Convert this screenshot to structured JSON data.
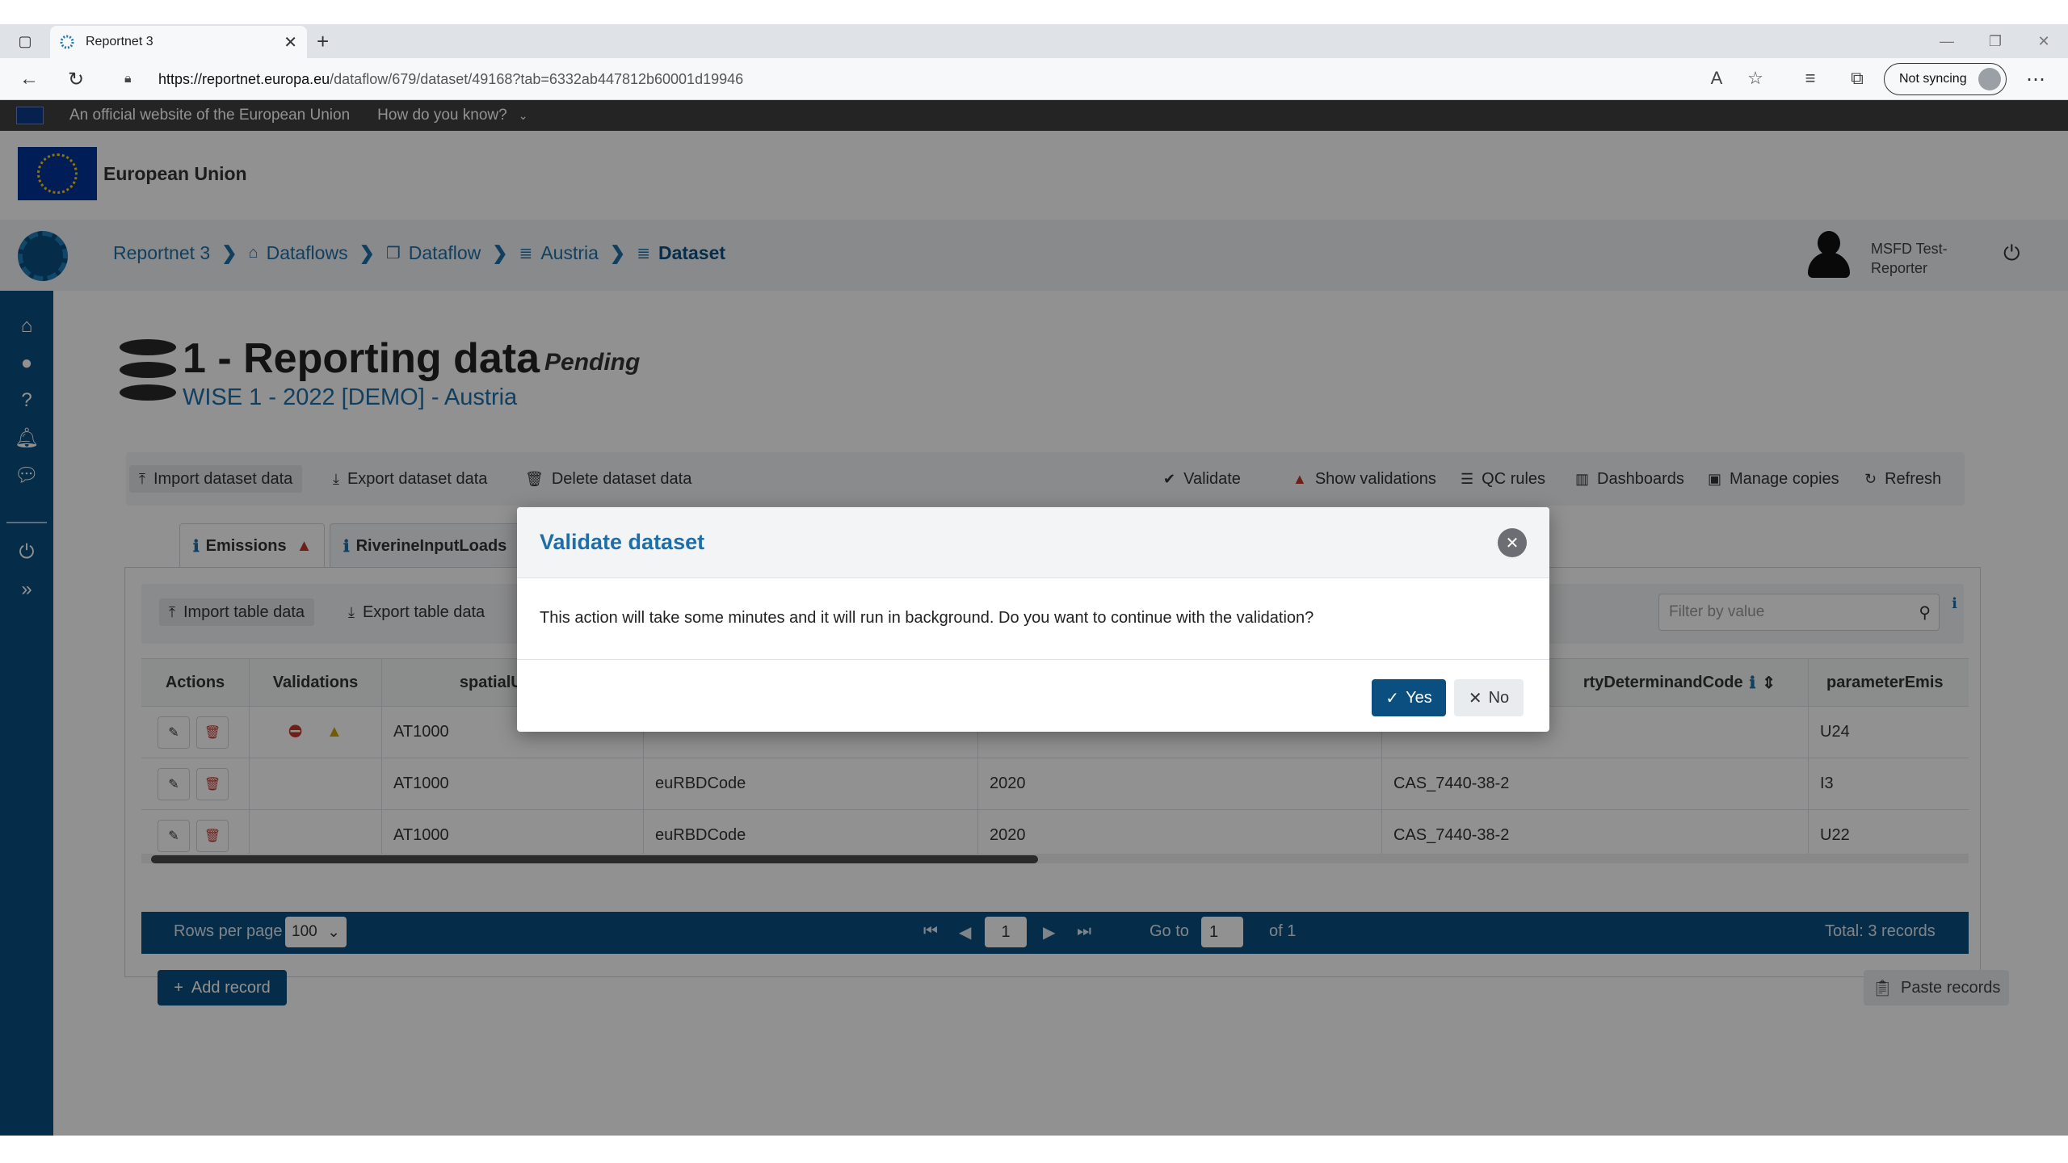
{
  "browser": {
    "tab_title": "Reportnet 3",
    "url_host": "https://reportnet.europa.eu",
    "url_path": "/dataflow/679/dataset/49168?tab=6332ab447812b60001d19946",
    "sync_label": "Not syncing"
  },
  "eu_banner": {
    "official_text": "An official website of the European Union",
    "how_label": "How do you know?",
    "org_name": "European Union"
  },
  "breadcrumbs": {
    "items": [
      "Reportnet 3",
      "Dataflows",
      "Dataflow",
      "Austria",
      "Dataset"
    ]
  },
  "user": {
    "name_line1": "MSFD Test-",
    "name_line2": "Reporter"
  },
  "dataset": {
    "title": "1 - Reporting data",
    "status": "Pending",
    "subtitle": "WISE 1 - 2022 [DEMO] - Austria"
  },
  "toolbar": {
    "import": "Import dataset data",
    "export": "Export dataset data",
    "delete": "Delete dataset data",
    "validate": "Validate",
    "show_validations": "Show validations",
    "qc_rules": "QC rules",
    "dashboards": "Dashboards",
    "manage_copies": "Manage copies",
    "refresh": "Refresh"
  },
  "tabs": [
    "Emissions",
    "RiverineInputLoads"
  ],
  "table_toolbar": {
    "import": "Import table data",
    "export": "Export table data",
    "filter_placeholder": "Filter by value"
  },
  "table": {
    "headers": [
      "Actions",
      "Validations",
      "spatialUnitIde",
      "",
      "",
      "rtyDeterminandCode",
      "parameterEmis"
    ],
    "rows": [
      {
        "spatial": "AT1000",
        "c4": "",
        "c5": "",
        "c6": "",
        "c7": "U24"
      },
      {
        "spatial": "AT1000",
        "c4": "euRBDCode",
        "c5": "2020",
        "c6": "CAS_7440-38-2",
        "c7": "I3"
      },
      {
        "spatial": "AT1000",
        "c4": "euRBDCode",
        "c5": "2020",
        "c6": "CAS_7440-38-2",
        "c7": "U22"
      }
    ]
  },
  "paginator": {
    "rows_per_page_label": "Rows per page",
    "rows_per_page_value": "100",
    "current_page": "1",
    "goto_label": "Go to",
    "goto_value": "1",
    "of_label": "of 1",
    "total": "Total: 3 records"
  },
  "actions": {
    "add_record": "Add record",
    "paste_records": "Paste records"
  },
  "dialog": {
    "title": "Validate dataset",
    "message": "This action will take some minutes and it will run in background. Do you want to continue with the validation?",
    "yes": "Yes",
    "no": "No"
  },
  "colors": {
    "primary": "#0a4f80",
    "link": "#1e6fa8",
    "warning": "#c0392b",
    "eu_blue": "#003399"
  }
}
